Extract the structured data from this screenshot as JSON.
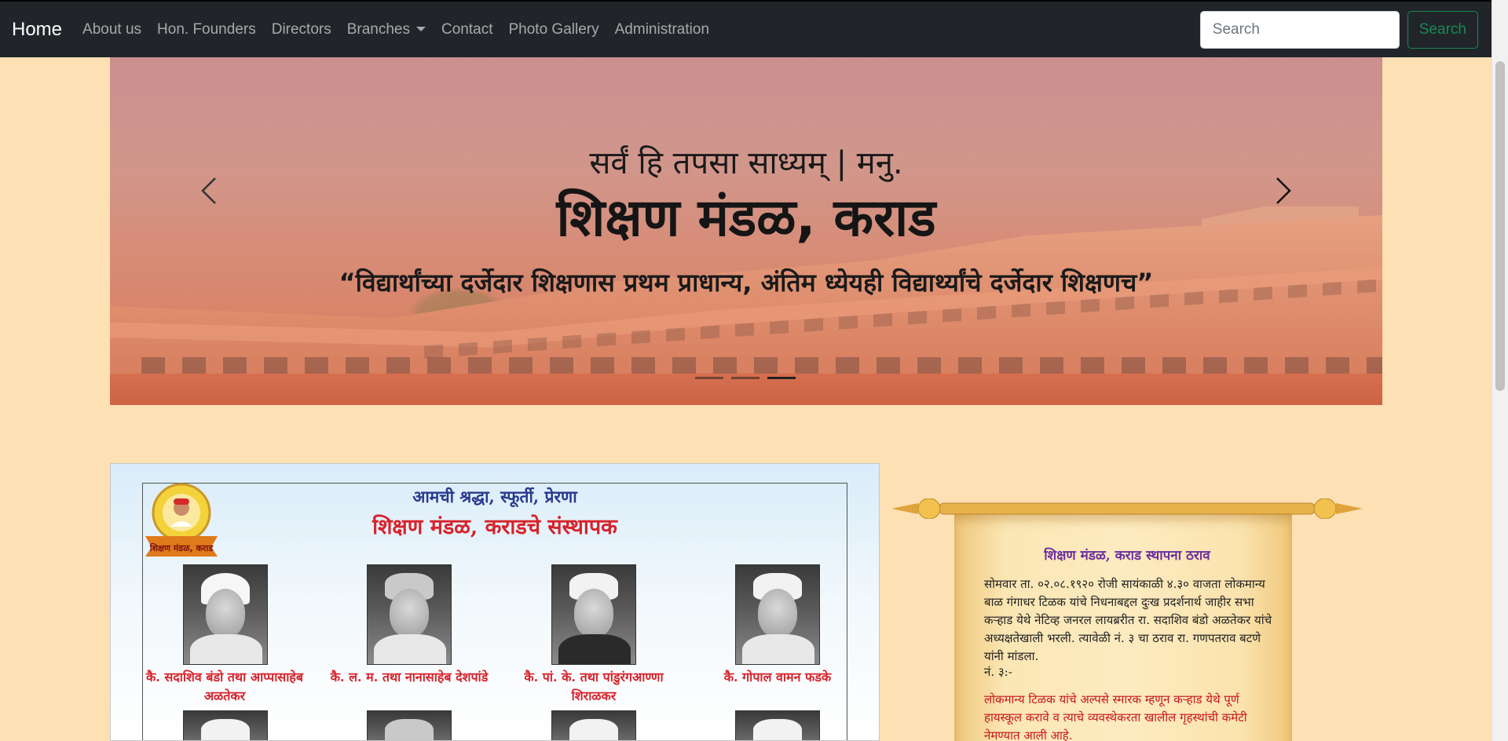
{
  "navbar": {
    "brand": "Home",
    "links": [
      {
        "label": "About us"
      },
      {
        "label": "Hon. Founders"
      },
      {
        "label": "Directors"
      },
      {
        "label": "Branches"
      },
      {
        "label": "Contact"
      },
      {
        "label": "Photo Gallery"
      },
      {
        "label": "Administration"
      }
    ],
    "search_placeholder": "Search",
    "search_button": "Search"
  },
  "carousel": {
    "motto": "सर्वं हि तपसा साध्यम् | मनु.",
    "title": "शिक्षण मंडळ, कराड",
    "tagline": "“विद्यार्थांच्या दर्जेदार शिक्षणास प्रथम प्राधान्य, अंतिम ध्येयही विद्यार्थ्यांचे दर्जेदार शिक्षणच”",
    "slide_count": 3,
    "active_slide": 3,
    "prev_icon": "chevron-left-icon",
    "next_icon": "chevron-right-icon"
  },
  "founders": {
    "heading_line1": "आमची श्रद्धा, स्फूर्ती, प्रेरणा",
    "heading_line2": "शिक्षण मंडळ, कराडचे संस्थापक",
    "emblem_text": "शिक्षण मंडळ, कराड",
    "names": [
      "कै. सदाशिव बंडो तथा आप्पासाहेब अळतेकर",
      "कै. ल. म. तथा नानासाहेब देशपांडे",
      "कै. पां. के. तथा पांडुरंगआण्णा शिराळकर",
      "कै. गोपाल वामन फडके"
    ]
  },
  "resolution": {
    "title": "शिक्षण मंडळ, कराड स्थापना ठराव",
    "paragraph1": "सोमवार ता. ०२.०८.१९२० रोजी सायंकाळी ४.३० वाजता लोकमान्य बाळ गंगाधर टिळक यांचे निधनाबद्दल दुःख प्रदर्शनार्थ जाहीर सभा कऱ्हाड येथे नेटिव्ह जनरल लायब्ररीत रा. सदाशिव बंडो अळतेकर यांचे अध्यक्षतेखाली भरली. त्यावेळी नं. ३ चा ठराव रा. गणपतराव बटणे यांनी मांडला.",
    "paragraph2": "नं. ३:-",
    "paragraph3": "लोकमान्य टिळक यांचे अल्पसे स्मारक म्हणून कऱ्हाड येथे पूर्ण हायस्कूल करावे व त्याचे व्यवस्थेकरता खालील गृहस्थांची कमेटी नेमण्यात आली आहे."
  },
  "colors": {
    "page_background": "#fde0b4",
    "navbar": "#212529",
    "search_button": "#198754",
    "founder_name": "#d6232b",
    "founder_heading": "#2a3a8e",
    "resolution_title": "#6b2fa0"
  }
}
